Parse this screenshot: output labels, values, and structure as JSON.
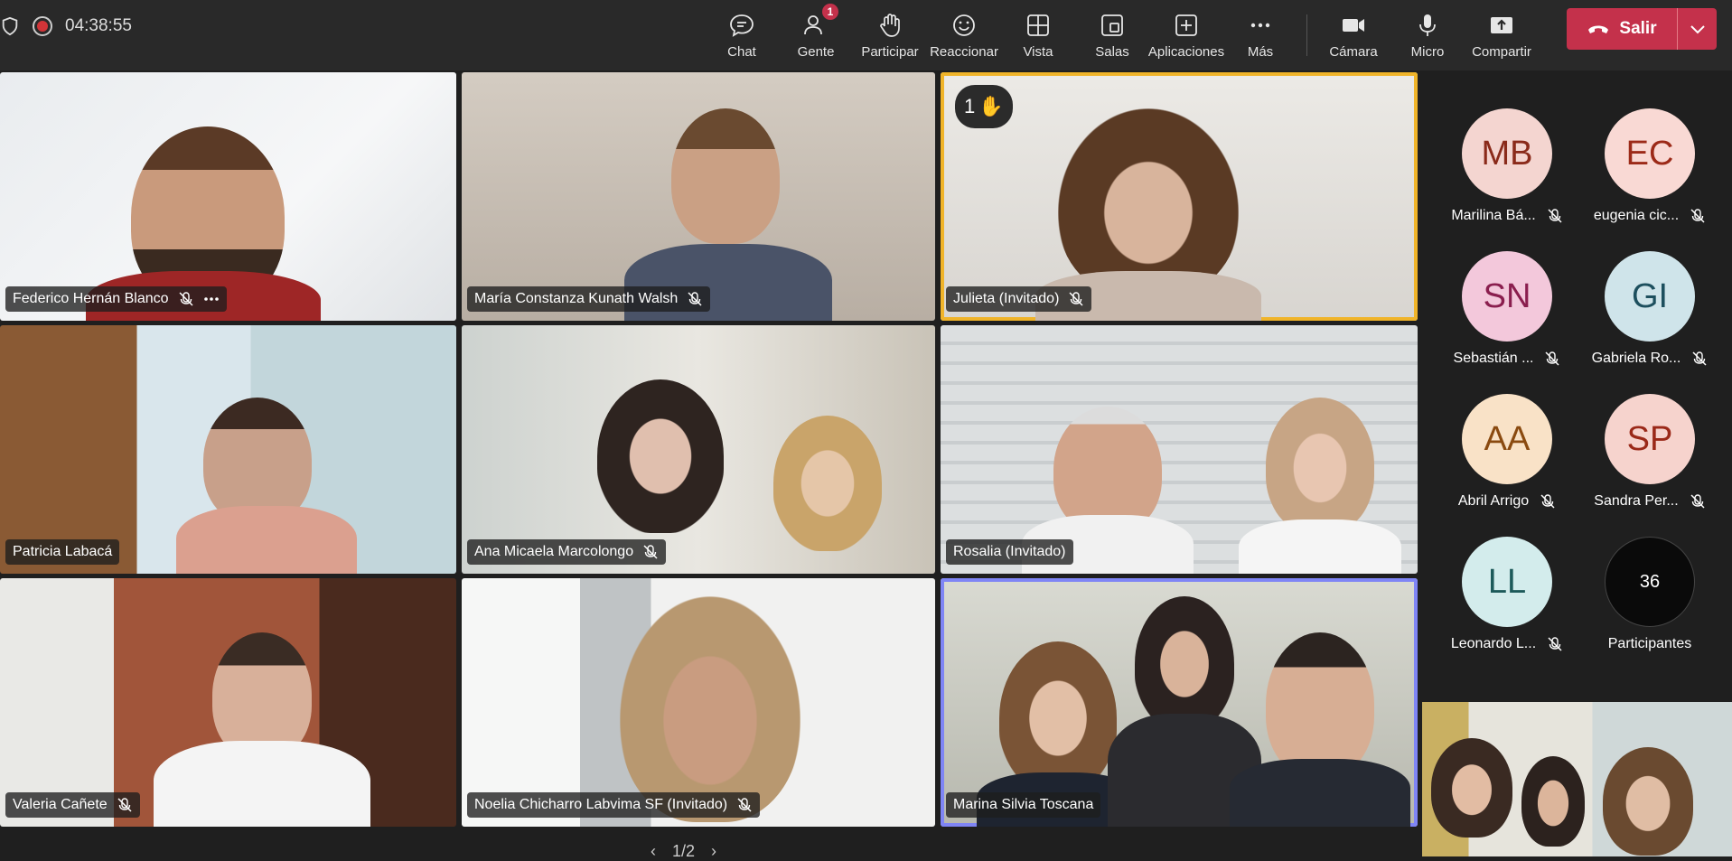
{
  "header": {
    "record_time": "04:38:55",
    "tools": [
      {
        "name": "chat",
        "label": "Chat"
      },
      {
        "name": "people",
        "label": "Gente",
        "badge": "1"
      },
      {
        "name": "raise-hand",
        "label": "Participar"
      },
      {
        "name": "react",
        "label": "Reaccionar"
      },
      {
        "name": "view",
        "label": "Vista"
      },
      {
        "name": "rooms",
        "label": "Salas"
      },
      {
        "name": "apps",
        "label": "Aplicaciones"
      },
      {
        "name": "more",
        "label": "Más"
      }
    ],
    "devices": [
      {
        "name": "camera",
        "label": "Cámara"
      },
      {
        "name": "mic",
        "label": "Micro"
      },
      {
        "name": "share",
        "label": "Compartir"
      }
    ],
    "leave_label": "Salir"
  },
  "tiles": [
    {
      "name": "Federico Hernán Blanco"
    },
    {
      "name": "María Constanza Kunath Walsh"
    },
    {
      "name": "Julieta (Invitado)",
      "hand": "1"
    },
    {
      "name": "Patricia Labacá"
    },
    {
      "name": "Ana Micaela Marcolongo"
    },
    {
      "name": "Rosalia (Invitado)"
    },
    {
      "name": "Valeria Cañete"
    },
    {
      "name": "Noelia Chicharro Labvima SF (Invitado)"
    },
    {
      "name": "Marina Silvia Toscana"
    }
  ],
  "roster": [
    {
      "initials": "MB",
      "name": "Marilina Bá...",
      "bg": "#f4d5d0",
      "fg": "#8a2a1a"
    },
    {
      "initials": "EC",
      "name": "eugenia cic...",
      "bg": "#f9d9d4",
      "fg": "#9c2a18"
    },
    {
      "initials": "SN",
      "name": "Sebastián ...",
      "bg": "#f3c8db",
      "fg": "#8a1e4e"
    },
    {
      "initials": "GI",
      "name": "Gabriela Ro...",
      "bg": "#cfe4ea",
      "fg": "#1d4f5e"
    },
    {
      "initials": "AA",
      "name": "Abril Arrigo",
      "bg": "#f9e2c7",
      "fg": "#8a4a10"
    },
    {
      "initials": "SP",
      "name": "Sandra Per...",
      "bg": "#f6d3cd",
      "fg": "#9a2818"
    },
    {
      "initials": "LL",
      "name": "Leonardo L...",
      "bg": "#d3ecec",
      "fg": "#1d5a5a"
    }
  ],
  "participants_count": "36",
  "participants_label": "Participantes",
  "pager": "1/2"
}
